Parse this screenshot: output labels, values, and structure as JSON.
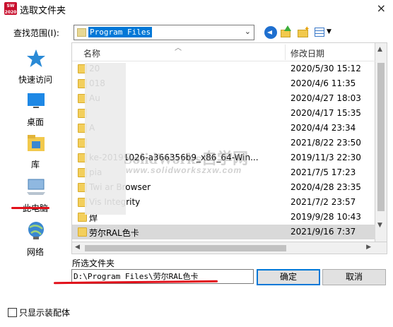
{
  "window": {
    "title": "选取文件夹",
    "app_badge": "SW 2020",
    "close_glyph": "×"
  },
  "lookin": {
    "label": "查找范围(I):",
    "value": "Program Files"
  },
  "places": [
    {
      "label": "快速访问",
      "icon": "star-icon"
    },
    {
      "label": "桌面",
      "icon": "desktop-icon"
    },
    {
      "label": "库",
      "icon": "library-icon"
    },
    {
      "label": "此电脑",
      "icon": "computer-icon"
    },
    {
      "label": "网络",
      "icon": "network-icon"
    }
  ],
  "columns": {
    "name": "名称",
    "date": "修改日期"
  },
  "rows": [
    {
      "name": "20",
      "date": "2020/5/30 15:12"
    },
    {
      "name": "018",
      "date": "2020/4/6 11:35"
    },
    {
      "name": "Au",
      "date": "2020/4/27 18:03"
    },
    {
      "name": "",
      "date": "2020/4/17 15:35"
    },
    {
      "name": "A",
      "date": "2020/4/4 23:34"
    },
    {
      "name": "",
      "date": "2021/8/22 23:50"
    },
    {
      "name": "ke-20191026-a366356b9_x86_64-Win...",
      "date": "2019/11/3 22:30"
    },
    {
      "name": "pia",
      "date": "2021/7/5 17:23"
    },
    {
      "name": "Twi     ar Browser",
      "date": "2020/4/28 23:35"
    },
    {
      "name": "Vis     Integrity",
      "date": "2021/7/2 23:57"
    },
    {
      "name": "焊",
      "date": "2019/9/28 10:43"
    },
    {
      "name": "劳尔RAL色卡",
      "date": "2021/9/16 7:37",
      "selected": true
    }
  ],
  "watermark": {
    "line1": "SolidWorks自学网",
    "line2": "www.solidworkszxw.com"
  },
  "selected_folder": {
    "label": "所选文件夹",
    "value": "D:\\Program Files\\劳尔RAL色卡"
  },
  "buttons": {
    "ok": "确定",
    "cancel": "取消"
  },
  "checkbox": {
    "label": "只显示装配体",
    "checked": false
  },
  "colors": {
    "accent": "#0078d7",
    "selected_row": "#d9d9d9",
    "annotation_red": "#e2101a",
    "folder": "#f3cf5c"
  }
}
